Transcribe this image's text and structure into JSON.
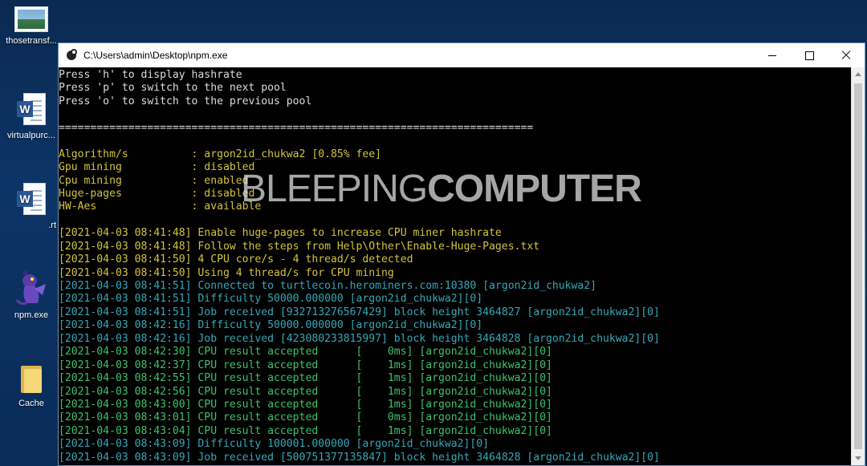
{
  "desktop": {
    "icons": [
      {
        "label": "thosetransf...",
        "icon": "image-file-icon"
      },
      {
        "label": "virtualpurc...",
        "icon": "word-document-icon"
      },
      {
        "label": ".rt",
        "icon": "word-document-icon"
      },
      {
        "label": "npm.exe",
        "icon": "dragon-exe-icon"
      },
      {
        "label": "Cache",
        "icon": "folder-icon"
      }
    ]
  },
  "window": {
    "title": "C:\\Users\\admin\\Desktop\\npm.exe",
    "controls": {
      "minimize": "minimize-icon",
      "maximize": "maximize-icon",
      "close": "close-icon"
    }
  },
  "console": {
    "lines": [
      {
        "t": "Press 'h' to display hashrate",
        "c": "white"
      },
      {
        "t": "Press 'p' to switch to the next pool",
        "c": "white"
      },
      {
        "t": "Press 'o' to switch to the previous pool",
        "c": "white"
      },
      {
        "t": "",
        "c": "white"
      },
      {
        "t": "===========================================================================",
        "c": "white"
      },
      {
        "t": "",
        "c": "white"
      },
      {
        "t": "Algorithm/s          : argon2id_chukwa2 [0.85% fee]",
        "c": "yellow"
      },
      {
        "t": "Gpu mining           : disabled",
        "c": "yellow"
      },
      {
        "t": "Cpu mining           : enabled",
        "c": "yellow"
      },
      {
        "t": "Huge-pages           : disabled",
        "c": "yellow"
      },
      {
        "t": "HW-Aes               : available",
        "c": "yellow"
      },
      {
        "t": "",
        "c": "white"
      },
      {
        "t": "[2021-04-03 08:41:48] Enable huge-pages to increase CPU miner hashrate",
        "c": "yellow"
      },
      {
        "t": "[2021-04-03 08:41:48] Follow the steps from Help\\Other\\Enable-Huge-Pages.txt",
        "c": "yellow"
      },
      {
        "t": "[2021-04-03 08:41:50] 4 CPU core/s - 4 thread/s detected",
        "c": "yellow"
      },
      {
        "t": "[2021-04-03 08:41:50] Using 4 thread/s for CPU mining",
        "c": "yellow"
      },
      {
        "t": "[2021-04-03 08:41:51] Connected to turtlecoin.herominers.com:10380 [argon2id_chukwa2]",
        "c": "cyan"
      },
      {
        "t": "[2021-04-03 08:41:51] Difficulty 50000.000000 [argon2id_chukwa2][0]",
        "c": "cyan"
      },
      {
        "t": "[2021-04-03 08:41:51] Job received [932713276567429] block height 3464827 [argon2id_chukwa2][0]",
        "c": "cyan"
      },
      {
        "t": "[2021-04-03 08:42:16] Difficulty 50000.000000 [argon2id_chukwa2][0]",
        "c": "cyan"
      },
      {
        "t": "[2021-04-03 08:42:16] Job received [423080233815997] block height 3464828 [argon2id_chukwa2][0]",
        "c": "cyan"
      },
      {
        "t": "[2021-04-03 08:42:30] CPU result accepted      [    0ms] [argon2id_chukwa2][0]",
        "c": "green"
      },
      {
        "t": "[2021-04-03 08:42:37] CPU result accepted      [    1ms] [argon2id_chukwa2][0]",
        "c": "green"
      },
      {
        "t": "[2021-04-03 08:42:55] CPU result accepted      [    1ms] [argon2id_chukwa2][0]",
        "c": "green"
      },
      {
        "t": "[2021-04-03 08:42:56] CPU result accepted      [    1ms] [argon2id_chukwa2][0]",
        "c": "green"
      },
      {
        "t": "[2021-04-03 08:43:00] CPU result accepted      [    1ms] [argon2id_chukwa2][0]",
        "c": "green"
      },
      {
        "t": "[2021-04-03 08:43:01] CPU result accepted      [    0ms] [argon2id_chukwa2][0]",
        "c": "green"
      },
      {
        "t": "[2021-04-03 08:43:04] CPU result accepted      [    1ms] [argon2id_chukwa2][0]",
        "c": "green"
      },
      {
        "t": "[2021-04-03 08:43:09] Difficulty 100001.000000 [argon2id_chukwa2][0]",
        "c": "cyan"
      },
      {
        "t": "[2021-04-03 08:43:09] Job received [500751377135847] block height 3464828 [argon2id_chukwa2][0]",
        "c": "cyan"
      }
    ]
  },
  "watermark": {
    "part1": "BLEEPING",
    "part2": "COMPUTER"
  },
  "colors": {
    "yellow": "#d2c43b",
    "green": "#3ec26b",
    "cyan": "#34a8b8",
    "white": "#dcdcdc"
  }
}
